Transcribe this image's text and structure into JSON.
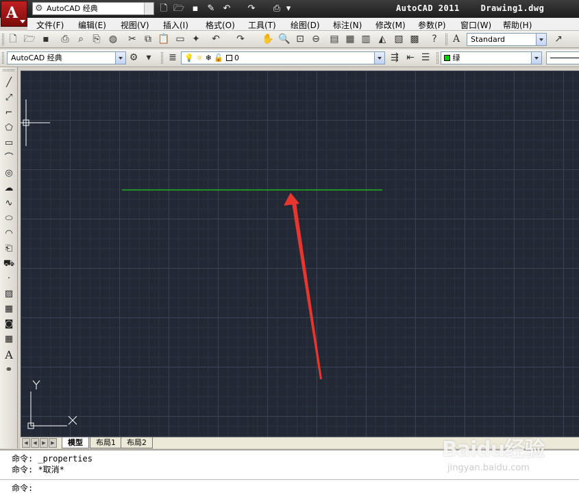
{
  "title_bar": {
    "workspace": "AutoCAD 经典",
    "app_name": "AutoCAD 2011",
    "document": "Drawing1.dwg"
  },
  "menu": {
    "items": [
      "文件(F)",
      "编辑(E)",
      "视图(V)",
      "插入(I)",
      "格式(O)",
      "工具(T)",
      "绘图(D)",
      "标注(N)",
      "修改(M)",
      "参数(P)",
      "窗口(W)",
      "帮助(H)"
    ]
  },
  "toolbar_std": {
    "text_style": "Standard"
  },
  "toolbar_layers": {
    "workspace": "AutoCAD 经典",
    "layer": "0",
    "color": "绿",
    "color_hex": "#00cc00"
  },
  "canvas": {
    "background": "#222834",
    "line_color": "#19c919",
    "arrow_color": "#e8352e",
    "ucs_x": "X",
    "ucs_y": "Y"
  },
  "layout_tabs": [
    "模型",
    "布局1",
    "布局2"
  ],
  "command": {
    "history": [
      "命令: _properties",
      "命令: *取消*"
    ],
    "prompt": "命令:"
  },
  "watermark": {
    "brand": "Baidu经验",
    "site": "jingyan.baidu.com"
  }
}
